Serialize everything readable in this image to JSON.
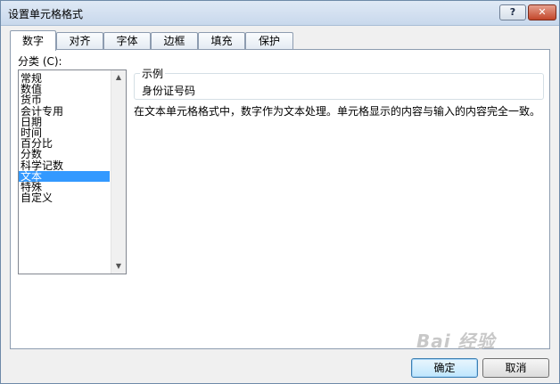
{
  "dialog": {
    "title": "设置单元格格式",
    "help_label": "?",
    "close_label": "✕"
  },
  "tabs": [
    {
      "label": "数字"
    },
    {
      "label": "对齐"
    },
    {
      "label": "字体"
    },
    {
      "label": "边框"
    },
    {
      "label": "填充"
    },
    {
      "label": "保护"
    }
  ],
  "category": {
    "label": "分类 (C):",
    "items": [
      "常规",
      "数值",
      "货币",
      "会计专用",
      "日期",
      "时间",
      "百分比",
      "分数",
      "科学记数",
      "文本",
      "特殊",
      "自定义"
    ],
    "selected": "文本"
  },
  "sample": {
    "legend": "示例",
    "value": "身份证号码"
  },
  "description": "在文本单元格格式中，数字作为文本处理。单元格显示的内容与输入的内容完全一致。",
  "buttons": {
    "ok": "确定",
    "cancel": "取消"
  },
  "watermark": "Bai 经验"
}
